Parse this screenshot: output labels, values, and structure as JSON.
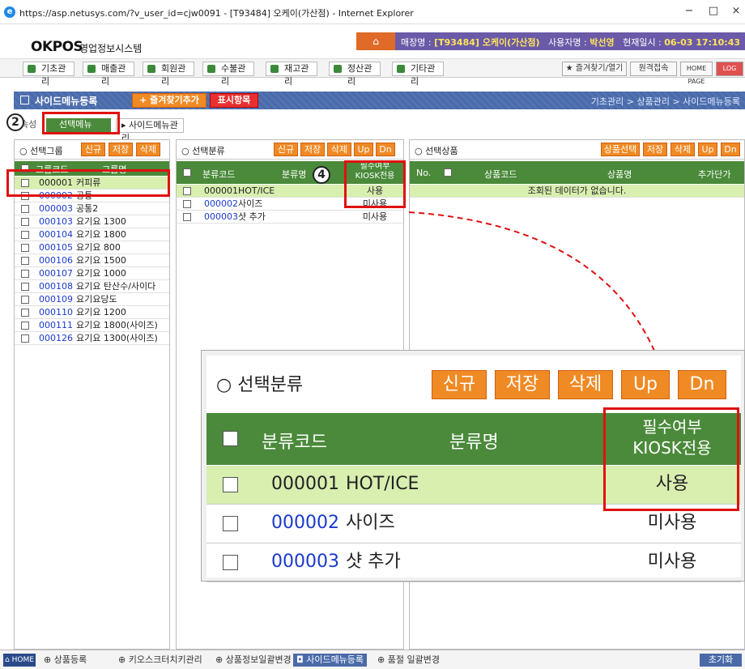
{
  "window": {
    "title": "https://asp.netusys.com/?v_user_id=cjw0091 - [T93484] 오케이(가산점) - Internet Explorer",
    "minimize": "−",
    "restore": "□",
    "close": "×"
  },
  "header": {
    "logo": "OKPOS",
    "subtitle": "영업정보시스템",
    "store_label": "매장명 :",
    "store": "[T93484] 오케이(가산점)",
    "user_label": "사용자명 :",
    "user": "박선영",
    "time_label": "현재일시 :",
    "time": "06-03 17:10:43"
  },
  "menu": {
    "items": [
      "기초관리",
      "매출관리",
      "회원관리",
      "수불관리",
      "재고관리",
      "정산관리",
      "기타관리"
    ],
    "favorites": "즐겨찾기/열기",
    "remote": "원격접속",
    "home": "HOME PAGE",
    "logout": "LOG OUT"
  },
  "subbar": {
    "title": "사이드메뉴등록",
    "add_fav": "+ 즐겨찾기추가",
    "display": "표시항목",
    "breadcrumb": "기초관리 > 상품관리 > 사이드메뉴등록"
  },
  "tabs": {
    "prefix": "속성",
    "select_menu": "선택메뉴",
    "side_menu_mgmt": "사이드메뉴관리"
  },
  "group_panel": {
    "title": "선택그룹",
    "btn_new": "신규",
    "btn_save": "저장",
    "btn_delete": "삭제",
    "col_code": "그룹코드",
    "col_name": "그룹명",
    "rows": [
      {
        "code": "000001",
        "name": "커피류"
      },
      {
        "code": "000002",
        "name": "공통"
      },
      {
        "code": "000003",
        "name": "공통2"
      },
      {
        "code": "000103",
        "name": "요기요 1300"
      },
      {
        "code": "000104",
        "name": "요기요 1800"
      },
      {
        "code": "000105",
        "name": "요기요 800"
      },
      {
        "code": "000106",
        "name": "요기요 1500"
      },
      {
        "code": "000107",
        "name": "요기요 1000"
      },
      {
        "code": "000108",
        "name": "요기요 탄산수/사이다"
      },
      {
        "code": "000109",
        "name": "요기요당도"
      },
      {
        "code": "000110",
        "name": "요기요 1200"
      },
      {
        "code": "000111",
        "name": "요기요 1800(사이즈)"
      },
      {
        "code": "000126",
        "name": "요기요 1300(사이즈)"
      }
    ]
  },
  "class_panel": {
    "title": "선택분류",
    "btn_new": "신규",
    "btn_save": "저장",
    "btn_delete": "삭제",
    "btn_up": "Up",
    "btn_dn": "Dn",
    "col_code": "분류코드",
    "col_name": "분류명",
    "col_req_1": "필수여부",
    "col_req_2": "KIOSK전용",
    "rows": [
      {
        "code": "000001",
        "name": "HOT/ICE",
        "req": "사용"
      },
      {
        "code": "000002",
        "name": "사이즈",
        "req": "미사용"
      },
      {
        "code": "000003",
        "name": "샷 추가",
        "req": "미사용"
      }
    ]
  },
  "product_panel": {
    "title": "선택상품",
    "btn_select": "상품선택",
    "btn_save": "저장",
    "btn_delete": "삭제",
    "btn_up": "Up",
    "btn_dn": "Dn",
    "col_no": "No.",
    "col_code": "상품코드",
    "col_name": "상품명",
    "col_price": "추가단가",
    "empty": "조회된 데이터가 없습니다."
  },
  "annotations": {
    "step2": "2",
    "step4": "4"
  },
  "taskbar": {
    "home": "HOME",
    "items": [
      "상품등록",
      "키오스크터치키관리",
      "상품정보일괄변경",
      "사이드메뉴등록",
      "품절 일괄변경"
    ],
    "reset": "초기화"
  },
  "colors": {
    "header_bar": "#6a5aa8",
    "orange_button": "#f08a24",
    "table_header": "#4a8a3a",
    "selected_row": "#d8efb0",
    "highlight": "#e01010"
  }
}
